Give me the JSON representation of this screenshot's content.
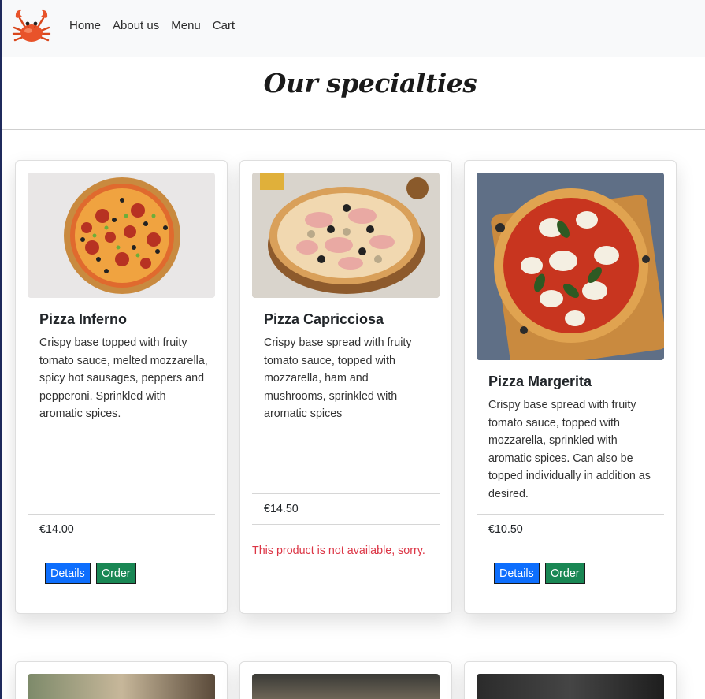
{
  "nav": {
    "logo_icon": "crab-logo-icon",
    "links": [
      "Home",
      "About us",
      "Menu",
      "Cart"
    ]
  },
  "page": {
    "title": "Our specialties"
  },
  "products": [
    {
      "name": "Pizza Inferno",
      "description": "Crispy base topped with fruity tomato sauce, melted mozzarella, spicy hot sausages, peppers and pepperoni. Sprinkled with aromatic spices.",
      "price": "€14.00",
      "details_label": "Details",
      "order_label": "Order"
    },
    {
      "name": "Pizza Capricciosa",
      "description": "Crispy base spread with fruity tomato sauce, topped with mozzarella, ham and mushrooms, sprinkled with aromatic spices",
      "price": "€14.50",
      "unavailable": "This product is not available, sorry."
    },
    {
      "name": "Pizza Margerita",
      "description": "Crispy base spread with fruity tomato sauce, topped with mozzarella, sprinkled with aromatic spices. Can also be topped individually in addition as desired.",
      "price": "€10.50",
      "details_label": "Details",
      "order_label": "Order"
    }
  ],
  "colors": {
    "details_button": "#0d6efd",
    "order_button": "#198754",
    "unavailable_text": "#dc3545",
    "navbar": "#f8f9fa"
  }
}
